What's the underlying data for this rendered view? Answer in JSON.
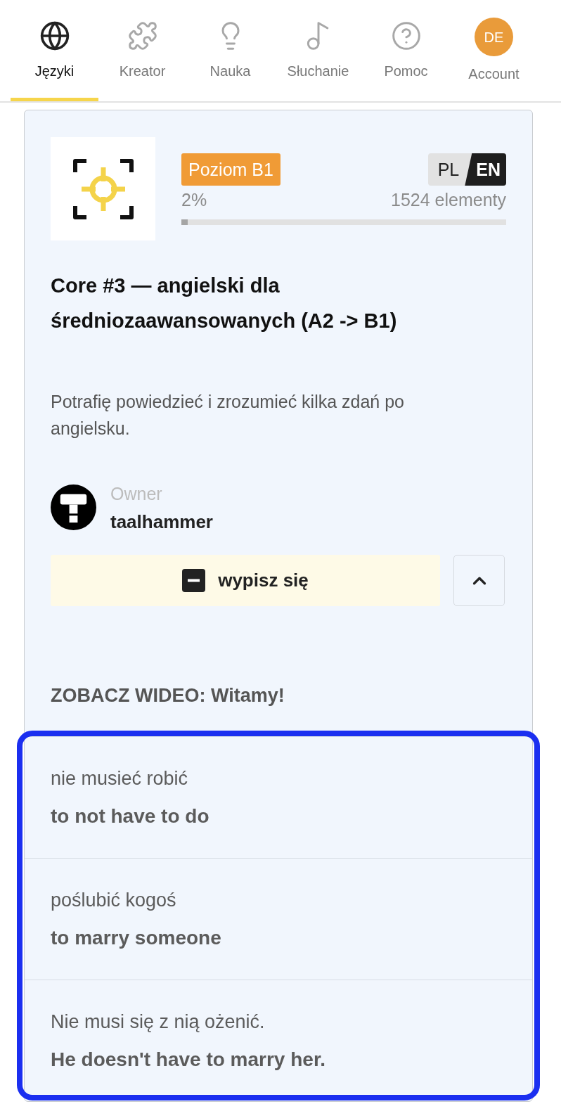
{
  "nav": {
    "tabs": [
      {
        "kind": "icon",
        "label": "Języki",
        "selected": true
      },
      {
        "kind": "icon",
        "label": "Kreator",
        "selected": false
      },
      {
        "kind": "icon",
        "label": "Nauka",
        "selected": false
      },
      {
        "kind": "icon",
        "label": "Słuchanie",
        "selected": false
      },
      {
        "kind": "icon",
        "label": "Pomoc",
        "selected": false
      },
      {
        "kind": "avatar",
        "initials": "DE",
        "label": "Account",
        "selected": false
      }
    ]
  },
  "course": {
    "level_badge": "Poziom B1",
    "languages": [
      {
        "label": "PL",
        "selected": false
      },
      {
        "label": "EN",
        "selected": true
      }
    ],
    "progress": {
      "percent": "2%",
      "count": "1524 elementy",
      "level": 0.02
    },
    "title": "Core #3 — angielski dla średniozaawansowanych (A2 -> B1)",
    "description": "Potrafię powiedzieć i zrozumieć kilka zdań po angielsku.",
    "owner": {
      "label": "Owner",
      "name": "taalhammer"
    },
    "unsubscribe_button": "wypisz się",
    "details_expanded": true,
    "video_link": "ZOBACZ WIDEO: Witamy!"
  },
  "phrases": {
    "highlighted": true,
    "items": [
      {
        "source": "nie musieć robić",
        "translation": "to not have to do"
      },
      {
        "source": "poślubić kogoś",
        "translation": "to marry someone"
      },
      {
        "source": "Nie musi się z nią ożenić.",
        "translation": "He doesn't have to marry her."
      }
    ]
  }
}
